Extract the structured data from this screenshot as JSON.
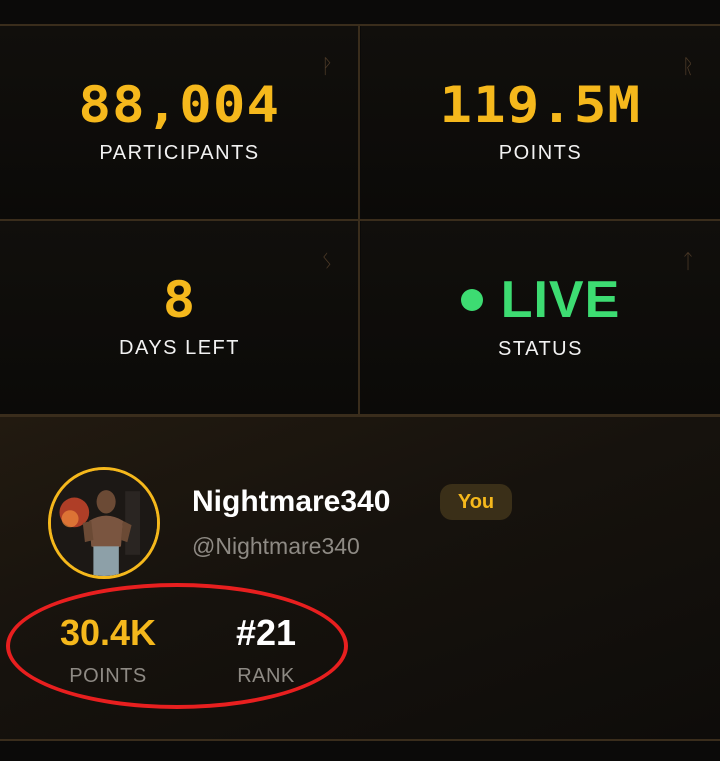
{
  "stats": [
    {
      "value": "88,004",
      "label": "PARTICIPANTS",
      "rune": "ᚹ"
    },
    {
      "value": "119.5M",
      "label": "POINTS",
      "rune": "ᚱ"
    },
    {
      "value": "8",
      "label": "DAYS LEFT",
      "rune": "ᛊ"
    },
    {
      "value": "LIVE",
      "label": "STATUS",
      "rune": "ᛏ"
    }
  ],
  "colors": {
    "accent": "#f5b81c",
    "live": "#3ddc72",
    "highlight": "#e81f1f"
  },
  "profile": {
    "username": "Nightmare340",
    "badge": "You",
    "handle": "@Nightmare340",
    "points_value": "30.4K",
    "points_label": "POINTS",
    "rank_value": "#21",
    "rank_label": "RANK"
  }
}
